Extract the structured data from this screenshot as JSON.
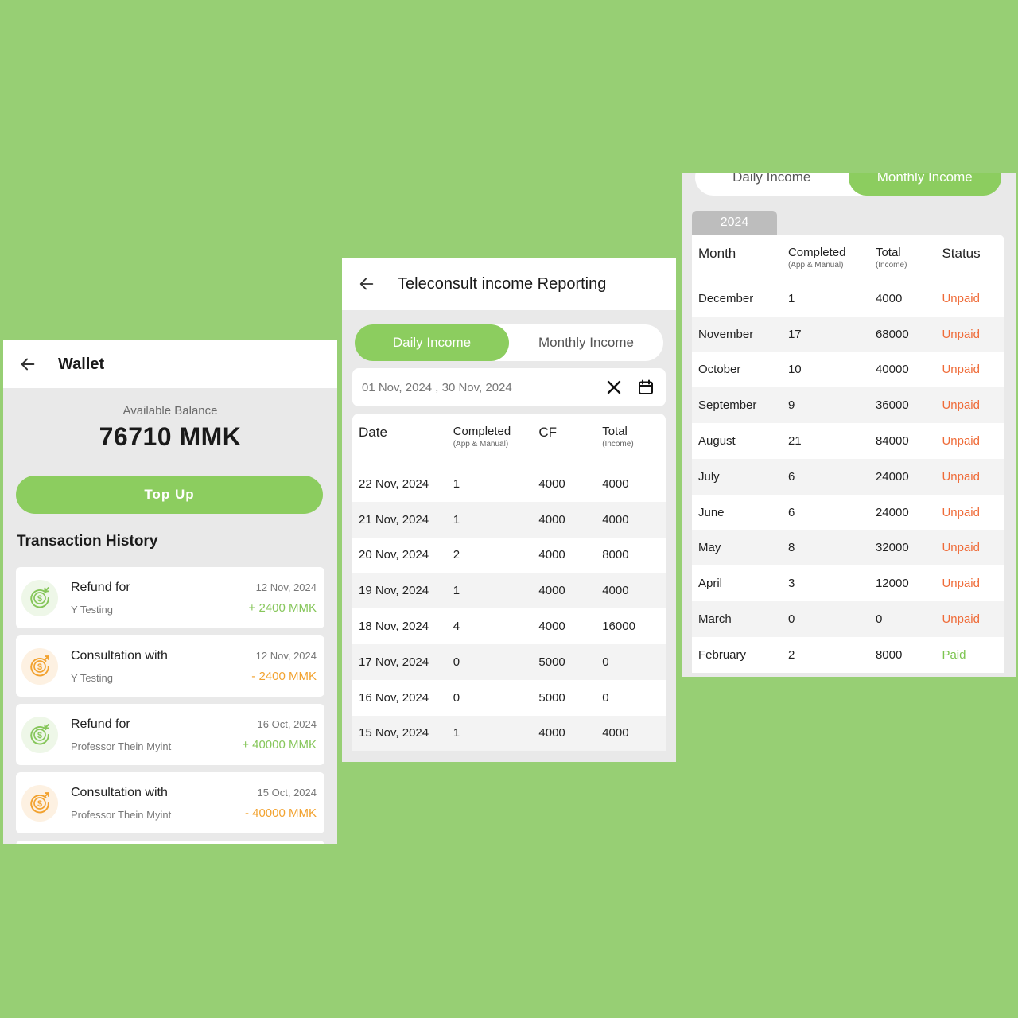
{
  "wallet": {
    "title": "Wallet",
    "balance_label": "Available Balance",
    "balance_value": "76710 MMK",
    "topup_label": "Top Up",
    "history_title": "Transaction History",
    "transactions": [
      {
        "title": "Refund for",
        "subtitle": "Y Testing",
        "date": "12 Nov, 2024",
        "amount": "+ 2400 MMK",
        "type": "refund",
        "icon": "refund-money-icon"
      },
      {
        "title": "Consultation with",
        "subtitle": "Y Testing",
        "date": "12 Nov, 2024",
        "amount": "- 2400 MMK",
        "type": "payment",
        "icon": "payment-money-icon"
      },
      {
        "title": "Refund for",
        "subtitle": "Professor Thein Myint",
        "date": "16 Oct, 2024",
        "amount": "+ 40000 MMK",
        "type": "refund",
        "icon": "refund-money-icon"
      },
      {
        "title": "Consultation with",
        "subtitle": "Professor Thein Myint",
        "date": "15 Oct, 2024",
        "amount": "- 40000 MMK",
        "type": "payment",
        "icon": "payment-money-icon"
      }
    ]
  },
  "daily": {
    "title": "Teleconsult income Reporting",
    "tabs": {
      "daily": "Daily Income",
      "monthly": "Monthly Income"
    },
    "date_range": "01 Nov, 2024 , 30 Nov, 2024",
    "headers": {
      "date": "Date",
      "completed": "Completed",
      "completed_sub": "(App & Manual)",
      "cf": "CF",
      "total": "Total",
      "total_sub": "(Income)"
    },
    "rows": [
      {
        "date": "22 Nov, 2024",
        "completed": "1",
        "cf": "4000",
        "total": "4000"
      },
      {
        "date": "21 Nov, 2024",
        "completed": "1",
        "cf": "4000",
        "total": "4000"
      },
      {
        "date": "20 Nov, 2024",
        "completed": "2",
        "cf": "4000",
        "total": "8000"
      },
      {
        "date": "19 Nov, 2024",
        "completed": "1",
        "cf": "4000",
        "total": "4000"
      },
      {
        "date": "18 Nov, 2024",
        "completed": "4",
        "cf": "4000",
        "total": "16000"
      },
      {
        "date": "17 Nov, 2024",
        "completed": "0",
        "cf": "5000",
        "total": "0"
      },
      {
        "date": "16 Nov, 2024",
        "completed": "0",
        "cf": "5000",
        "total": "0"
      },
      {
        "date": "15 Nov, 2024",
        "completed": "1",
        "cf": "4000",
        "total": "4000"
      }
    ]
  },
  "monthly": {
    "tabs": {
      "daily": "Daily Income",
      "monthly": "Monthly Income"
    },
    "year": "2024",
    "headers": {
      "month": "Month",
      "completed": "Completed",
      "completed_sub": "(App & Manual)",
      "total": "Total",
      "total_sub": "(Income)",
      "status": "Status"
    },
    "rows": [
      {
        "month": "December",
        "completed": "1",
        "total": "4000",
        "status": "Unpaid"
      },
      {
        "month": "November",
        "completed": "17",
        "total": "68000",
        "status": "Unpaid"
      },
      {
        "month": "October",
        "completed": "10",
        "total": "40000",
        "status": "Unpaid"
      },
      {
        "month": "September",
        "completed": "9",
        "total": "36000",
        "status": "Unpaid"
      },
      {
        "month": "August",
        "completed": "21",
        "total": "84000",
        "status": "Unpaid"
      },
      {
        "month": "July",
        "completed": "6",
        "total": "24000",
        "status": "Unpaid"
      },
      {
        "month": "June",
        "completed": "6",
        "total": "24000",
        "status": "Unpaid"
      },
      {
        "month": "May",
        "completed": "8",
        "total": "32000",
        "status": "Unpaid"
      },
      {
        "month": "April",
        "completed": "3",
        "total": "12000",
        "status": "Unpaid"
      },
      {
        "month": "March",
        "completed": "0",
        "total": "0",
        "status": "Unpaid"
      },
      {
        "month": "February",
        "completed": "2",
        "total": "8000",
        "status": "Paid"
      }
    ]
  },
  "colors": {
    "background": "#97cf74",
    "accent_green": "#8ccd5f",
    "refund_green": "#86c65a",
    "payment_orange": "#f2a22f",
    "unpaid_red": "#ef6b38",
    "paid_green": "#7cc44f"
  }
}
